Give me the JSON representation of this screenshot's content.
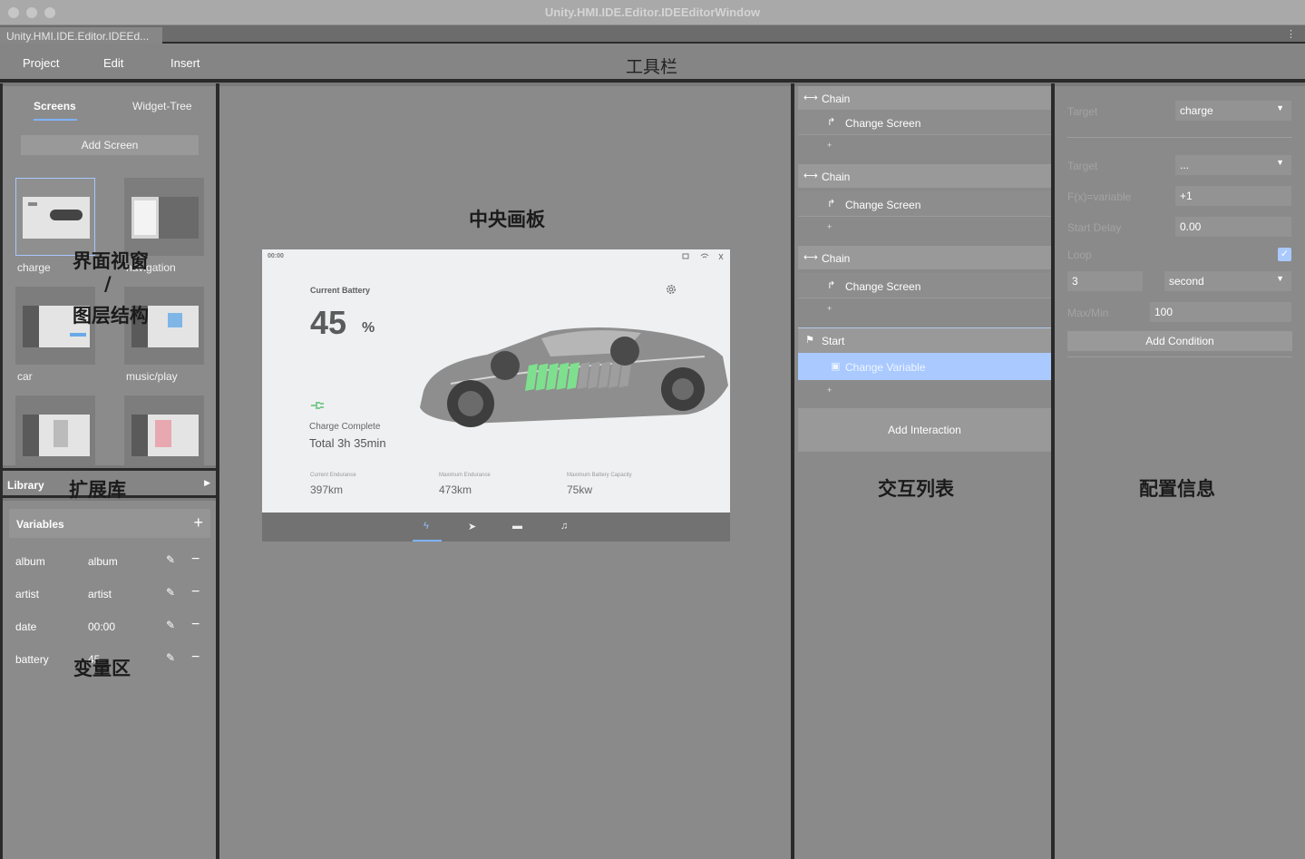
{
  "window": {
    "title": "Unity.HMI.IDE.Editor.IDEEditorWindow",
    "tab_label": "Unity.HMI.IDE.Editor.IDEEd...",
    "tab_menu_icon": "kebab-icon"
  },
  "toolbar": {
    "menus": [
      "Project",
      "Edit",
      "Insert"
    ],
    "zone_label": "工具栏"
  },
  "left_panel": {
    "tabs": [
      "Screens",
      "Widget-Tree"
    ],
    "active_tab": "Screens",
    "add_screen_label": "Add Screen",
    "screens": [
      "charge",
      "navigation",
      "car",
      "music/play",
      "",
      ""
    ],
    "zone_label_1": "界面视窗",
    "zone_label_slash": "/",
    "zone_label_2": "图层结构"
  },
  "library": {
    "label": "Library",
    "zone_label": "扩展库"
  },
  "variables": {
    "header": "Variables",
    "zone_label": "变量区",
    "rows": [
      {
        "name": "album",
        "value": "album"
      },
      {
        "name": "artist",
        "value": "artist"
      },
      {
        "name": "date",
        "value": "00:00"
      },
      {
        "name": "battery",
        "value": "45"
      }
    ]
  },
  "canvas": {
    "zone_label": "中央画板",
    "screen": {
      "clock": "00:00",
      "battery_title": "Current Battery",
      "battery_value": "45",
      "battery_unit": "%",
      "charge_status": "Charge Complete",
      "total_time": "Total 3h 35min",
      "stats": [
        {
          "label": "Current Endurance",
          "value": "397km"
        },
        {
          "label": "Maximum Endurance",
          "value": "473km"
        },
        {
          "label": "Maximum Battery Capacity",
          "value": "75kw"
        }
      ],
      "nav_icons": [
        "bolt-icon",
        "navigation-arrow-icon",
        "car-icon",
        "music-note-icon"
      ],
      "battery_level": 0.45
    }
  },
  "interactions": {
    "zone_label": "交互列表",
    "groups": [
      {
        "head": "Chain",
        "action": "Change Screen"
      },
      {
        "head": "Chain",
        "action": "Change Screen"
      },
      {
        "head": "Chain",
        "action": "Change Screen"
      },
      {
        "head": "Start",
        "action": "Change Variable"
      }
    ],
    "plus": "+",
    "add_label": "Add Interaction"
  },
  "config": {
    "zone_label": "配置信息",
    "target_label": "Target",
    "target_value": "charge",
    "target2_label": "Target",
    "target2_value": "...",
    "fx_label": "F(x)=variable",
    "fx_value": "+1",
    "delay_label": "Start Delay",
    "delay_value": "0.00",
    "loop_label": "Loop",
    "loop_checked": true,
    "count_value": "3",
    "unit_value": "second",
    "maxmin_label": "Max/Min",
    "maxmin_value": "100",
    "add_condition_label": "Add Condition"
  },
  "colors": {
    "accent": "#7fb2ff",
    "selection": "#a9c9ff",
    "divider": "#2a2a2a",
    "battery_fill": "#7ee08e"
  }
}
